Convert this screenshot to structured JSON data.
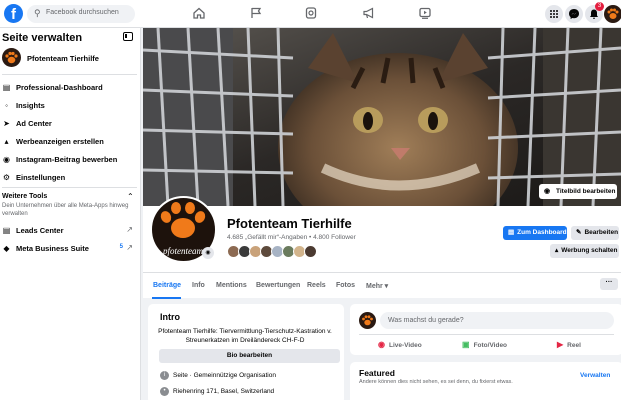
{
  "topbar": {
    "logo": "f",
    "search_placeholder": "Facebook durchsuchen",
    "notification_count": "3",
    "accent": "#1877f2"
  },
  "sidebar": {
    "title": "Seite verwalten",
    "page_name": "Pfotenteam Tierhilfe",
    "items": [
      {
        "label": "Professional-Dashboard",
        "icon": "dashboard-icon"
      },
      {
        "label": "Insights",
        "icon": "insights-icon"
      },
      {
        "label": "Ad Center",
        "icon": "ad-center-icon"
      },
      {
        "label": "Werbeanzeigen erstellen",
        "icon": "megaphone-icon"
      },
      {
        "label": "Instagram-Beitrag bewerben",
        "icon": "instagram-icon"
      },
      {
        "label": "Einstellungen",
        "icon": "gear-icon"
      }
    ],
    "more_tools_title": "Weitere Tools",
    "more_tools_desc": "Dein Unternehmen über alle Meta-Apps hinweg verwalten",
    "tools": [
      {
        "label": "Leads Center"
      },
      {
        "label": "Meta Business Suite",
        "badge": "5"
      }
    ]
  },
  "cover": {
    "edit_label": "Titelbild bearbeiten"
  },
  "profile": {
    "name": "Pfotenteam Tierhilfe",
    "stats": "4.685 „Gefällt mir“-Angaben • 4.800 Follower",
    "logo_text": "pfotenteam",
    "buttons": {
      "dashboard": "Zum Dashboard",
      "edit": "Bearbeiten",
      "promote": "Werbung schalten"
    }
  },
  "tabs": [
    "Beiträge",
    "Info",
    "Mentions",
    "Bewertungen",
    "Reels",
    "Fotos",
    "Mehr ▾"
  ],
  "more_button": "···",
  "intro": {
    "title": "Intro",
    "description": "Pfotenteam Tierhilfe: Tiervermittlung-Tierschutz-Kastration v. Streunerkatzen im Dreiländereck CH-F-D",
    "edit_bio": "Bio bearbeiten",
    "category": "Seite · Gemeinnützige Organisation",
    "address": "Riehenring 171, Basel, Switzerland"
  },
  "composer": {
    "placeholder": "Was machst du gerade?",
    "live": "Live-Video",
    "photo": "Foto/Video",
    "reel": "Reel"
  },
  "featured": {
    "title": "Featured",
    "description": "Andere können dies nicht sehen, es sei denn, du fixierst etwas.",
    "manage": "Verwalten"
  }
}
